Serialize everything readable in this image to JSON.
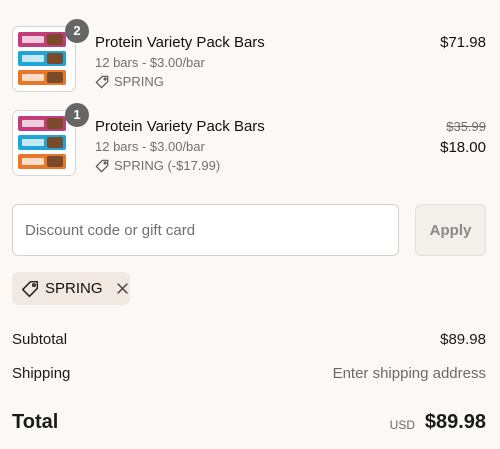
{
  "line_items": [
    {
      "quantity": "2",
      "title": "Protein Variety Pack Bars",
      "variant": "12 bars - $3.00/bar",
      "discount_label": "SPRING",
      "price": "$71.98"
    },
    {
      "quantity": "1",
      "title": "Protein Variety Pack Bars",
      "variant": "12 bars - $3.00/bar",
      "discount_label": "SPRING (-$17.99)",
      "original_price": "$35.99",
      "price": "$18.00"
    }
  ],
  "discount": {
    "placeholder": "Discount code or gift card",
    "value": "",
    "apply_label": "Apply",
    "applied_code": "SPRING"
  },
  "summary": {
    "subtotal_label": "Subtotal",
    "subtotal_value": "$89.98",
    "shipping_label": "Shipping",
    "shipping_value": "Enter shipping address",
    "total_label": "Total",
    "currency": "USD",
    "total_value": "$89.98"
  },
  "icons": {
    "tag": "tag-icon",
    "close": "close-icon"
  }
}
